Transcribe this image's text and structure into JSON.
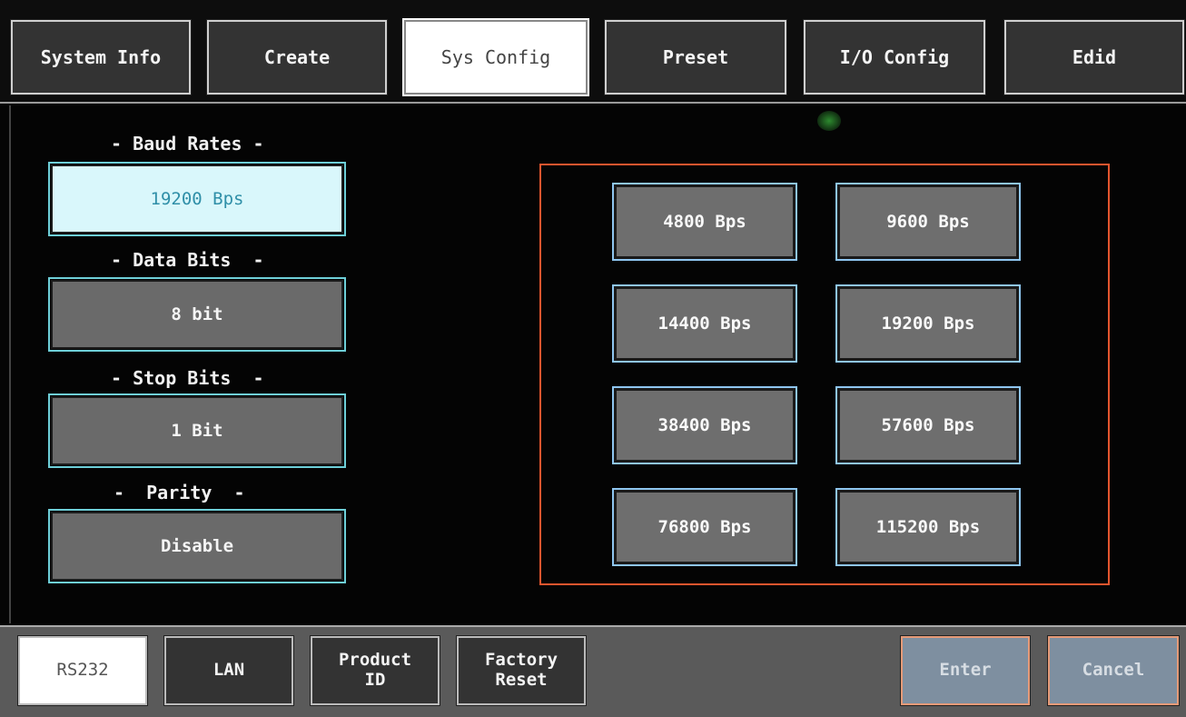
{
  "tabs": [
    {
      "label": "System Info",
      "active": false
    },
    {
      "label": "Create",
      "active": false
    },
    {
      "label": "Sys Config",
      "active": true
    },
    {
      "label": "Preset",
      "active": false
    },
    {
      "label": "I/O Config",
      "active": false
    },
    {
      "label": "Edid",
      "active": false
    }
  ],
  "settings": {
    "baud": {
      "label": "- Baud Rates -",
      "value": "19200 Bps"
    },
    "data_bits": {
      "label": "- Data Bits  -",
      "value": "8 bit"
    },
    "stop_bits": {
      "label": "- Stop Bits  -",
      "value": "1 Bit"
    },
    "parity": {
      "label": "-  Parity  -",
      "value": "Disable"
    }
  },
  "baud_options": [
    "4800 Bps",
    "9600 Bps",
    "14400 Bps",
    "19200 Bps",
    "38400 Bps",
    "57600 Bps",
    "76800 Bps",
    "115200 Bps"
  ],
  "bottom": {
    "rs232": "RS232",
    "lan": "LAN",
    "product_id": "Product\nID",
    "factory_reset": "Factory\nReset",
    "enter": "Enter",
    "cancel": "Cancel"
  },
  "colors": {
    "selected_field": "#d9f7fb",
    "field_outline": "#6ecfd8",
    "options_frame": "#e3552e",
    "option_outline": "#8fc6f0"
  }
}
